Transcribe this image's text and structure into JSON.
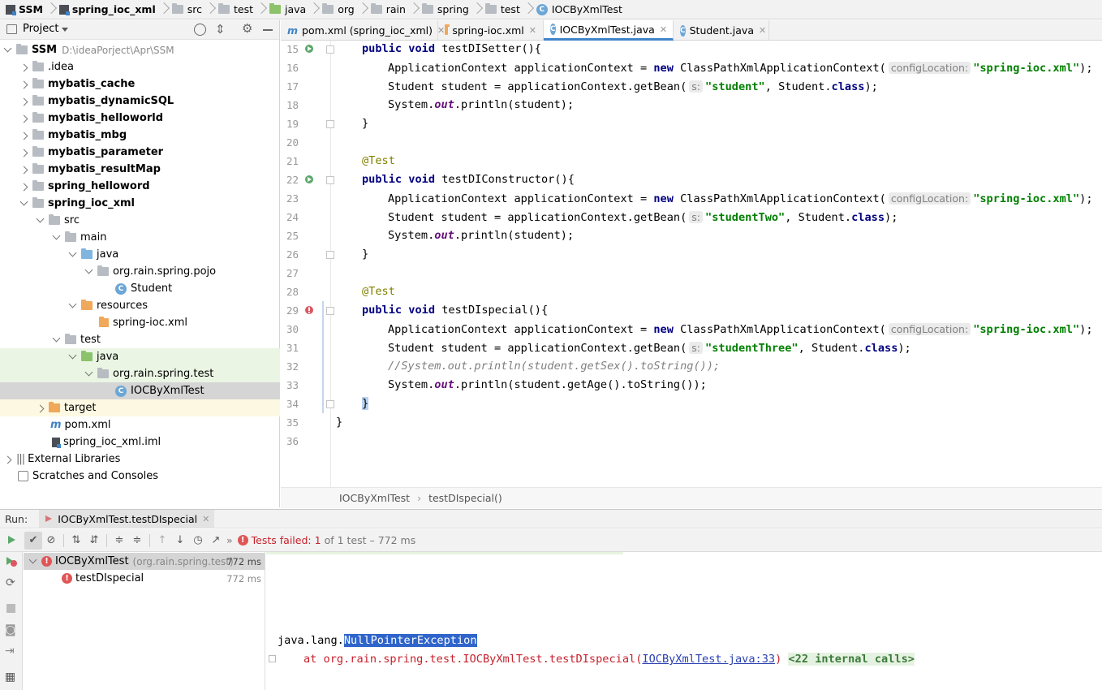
{
  "breadcrumb": [
    "SSM",
    "spring_ioc_xml",
    "src",
    "test",
    "java",
    "org",
    "rain",
    "spring",
    "test",
    "IOCByXmlTest"
  ],
  "project_panel": {
    "title": "Project",
    "root": {
      "name": "SSM",
      "path": "D:\\ideaPorject\\Apr\\SSM"
    },
    "items": [
      ".idea",
      "mybatis_cache",
      "mybatis_dynamicSQL",
      "mybatis_helloworld",
      "mybatis_mbg",
      "mybatis_parameter",
      "mybatis_resultMap",
      "spring_helloword",
      "spring_ioc_xml",
      "src",
      "main",
      "java",
      "org.rain.spring.pojo",
      "Student",
      "resources",
      "spring-ioc.xml",
      "test",
      "java",
      "org.rain.spring.test",
      "IOCByXmlTest",
      "target",
      "pom.xml",
      "spring_ioc_xml.iml",
      "External Libraries",
      "Scratches and Consoles"
    ]
  },
  "tabs": [
    {
      "label": "pom.xml (spring_ioc_xml)",
      "icon": "maven-icon"
    },
    {
      "label": "spring-ioc.xml",
      "icon": "xml-icon"
    },
    {
      "label": "IOCByXmlTest.java",
      "icon": "class-icon",
      "active": true
    },
    {
      "label": "Student.java",
      "icon": "class-icon"
    }
  ],
  "editor": {
    "line_numbers": [
      "15",
      "16",
      "17",
      "18",
      "19",
      "20",
      "21",
      "22",
      "23",
      "24",
      "25",
      "26",
      "27",
      "28",
      "29",
      "30",
      "31",
      "32",
      "33",
      "34",
      "35",
      "36"
    ],
    "tokens": {
      "public": "public",
      "void": "void",
      "new": "new",
      "class": "class",
      "test": "@Test",
      "m1": "testDISetter(){",
      "m2": "testDIConstructor(){",
      "m3": "testDIspecial(){",
      "ac_decl": "ApplicationContext applicationContext = ",
      "cpx": "ClassPathXmlApplicationContext(",
      "hint_config": "configLocation:",
      "xml_str": "\"spring-ioc.xml\"",
      "close_paren_semi": ");",
      "st_decl": "Student student = applicationContext.getBean(",
      "hint_s": "s:",
      "s_student": "\"student\"",
      "s_studentTwo": "\"studentTwo\"",
      "s_studentThree": "\"studentThree\"",
      "student_class": ", Student.",
      "sys": "System.",
      "out": "out",
      "println_student": ".println(student);",
      "comment": "//System.out.println(student.getSex().toString());",
      "println_age": ".println(student.getAge().toString());",
      "brace_close": "}"
    },
    "breadcrumb": [
      "IOCByXmlTest",
      "testDIspecial()"
    ]
  },
  "run": {
    "label": "Run:",
    "tab": "IOCByXmlTest.testDIspecial",
    "status_prefix": "Tests failed:",
    "failed_count": "1",
    "status_suffix": "of 1 test – 772 ms",
    "tree": [
      {
        "name": "IOCByXmlTest",
        "pkg": "(org.rain.spring.test)",
        "time": "772 ms"
      },
      {
        "name": "testDIspecial",
        "time": "772 ms"
      }
    ],
    "console": {
      "exc_prefix": "java.lang.",
      "exc_name": "NullPointerException",
      "at_line": "at org.rain.spring.test.IOCByXmlTest.testDIspecial(",
      "link": "IOCByXmlTest.java:33",
      "close": ")",
      "internal": "<22 internal calls>"
    }
  },
  "colors": {
    "accent": "#4083c9",
    "error": "#e05555",
    "keyword": "#000080",
    "string": "#008000",
    "annotation": "#808000"
  }
}
